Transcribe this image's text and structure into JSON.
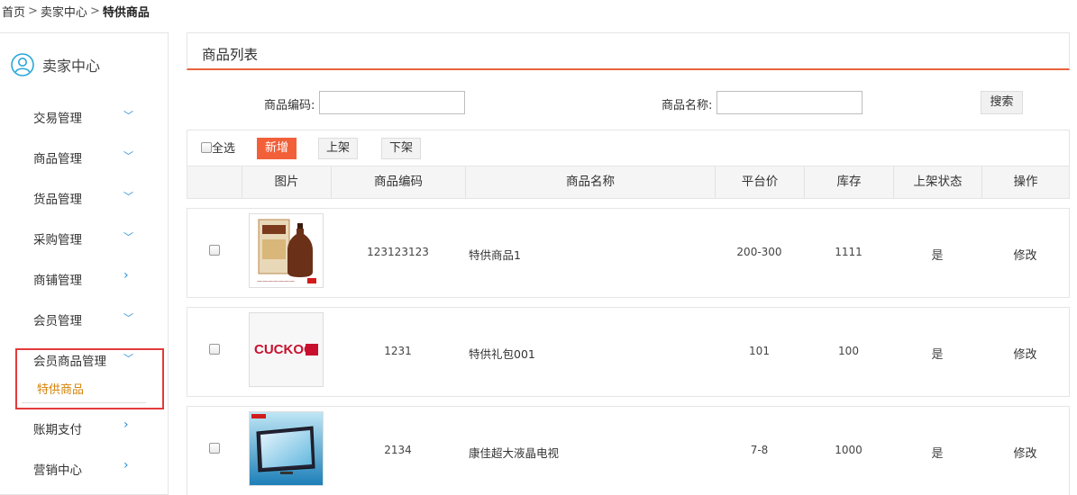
{
  "breadcrumb": {
    "home": "首页",
    "seller_center": "卖家中心",
    "current": "特供商品"
  },
  "sidebar": {
    "title": "卖家中心",
    "items": [
      {
        "label": "交易管理",
        "chevron": "﹀"
      },
      {
        "label": "商品管理",
        "chevron": "﹀"
      },
      {
        "label": "货品管理",
        "chevron": "﹀"
      },
      {
        "label": "采购管理",
        "chevron": "﹀"
      },
      {
        "label": "商铺管理",
        "chevron": "›"
      },
      {
        "label": "会员管理",
        "chevron": "﹀"
      },
      {
        "label": "会员商品管理",
        "chevron": "﹀"
      },
      {
        "label": "账期支付",
        "chevron": "›"
      },
      {
        "label": "营销中心",
        "chevron": "›"
      }
    ],
    "active_sub": "特供商品"
  },
  "panel": {
    "title": "商品列表"
  },
  "search": {
    "code_label": "商品编码:",
    "code_value": "",
    "name_label": "商品名称:",
    "name_value": "",
    "button": "搜索"
  },
  "toolbar": {
    "select_all": "全选",
    "add": "新增",
    "on_shelf": "上架",
    "off_shelf": "下架"
  },
  "table": {
    "headers": [
      "图片",
      "商品编码",
      "商品名称",
      "平台价",
      "库存",
      "上架状态",
      "操作"
    ],
    "rows": [
      {
        "image": "liquor-bottle-image",
        "code": "123123123",
        "name": "特供商品1",
        "price": "200-300",
        "stock": "1111",
        "status": "是",
        "action": "修改"
      },
      {
        "image": "cuckoo-logo-image",
        "code": "1231",
        "name": "特供礼包001",
        "price": "101",
        "stock": "100",
        "status": "是",
        "action": "修改"
      },
      {
        "image": "lcd-tv-image",
        "code": "2134",
        "name": "康佳超大液晶电视",
        "price": "7-8",
        "stock": "1000",
        "status": "是",
        "action": "修改"
      }
    ]
  },
  "colors": {
    "accent": "#f2603a",
    "active_sub": "#d48306",
    "chevron": "#2a8fd6",
    "highlight": "#e23b3b"
  }
}
